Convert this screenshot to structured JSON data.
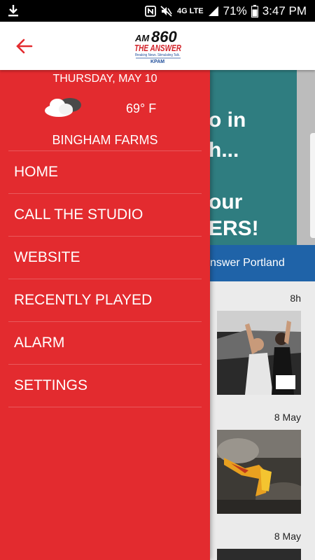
{
  "status_bar": {
    "network": "4G LTE",
    "battery": "71%",
    "time": "3:47 PM"
  },
  "header": {
    "back_icon": "arrow-left-icon",
    "logo": {
      "am": "AM",
      "freq": "860",
      "name": "THE ANSWER",
      "tagline": "Breaking News. Stimulating Talk.",
      "call": "KPAM"
    }
  },
  "drawer": {
    "date": "THURSDAY, MAY 10",
    "weather_icon": "cloud-icon",
    "temperature": "69° F",
    "location": "BINGHAM FARMS",
    "menu": [
      {
        "label": "HOME"
      },
      {
        "label": "CALL THE STUDIO"
      },
      {
        "label": "WEBSITE"
      },
      {
        "label": "RECENTLY PLAYED"
      },
      {
        "label": "ALARM"
      },
      {
        "label": "SETTINGS"
      }
    ]
  },
  "background": {
    "promo_lines": [
      "o in",
      "h...",
      "our",
      "ERS!"
    ],
    "station_label": "nswer Portland",
    "feed_times": [
      "8h",
      "8 May",
      "8 May"
    ]
  },
  "colors": {
    "drawer_red": "#e32b2f",
    "promo_teal": "#2f7d80",
    "station_blue": "#1f63a8",
    "back_arrow": "#e32b2f"
  }
}
